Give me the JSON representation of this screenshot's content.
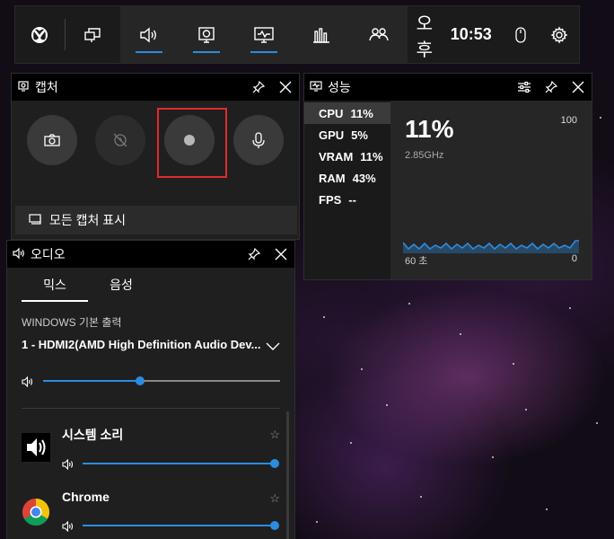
{
  "topbar": {
    "clock_ampm": "오후",
    "clock_time": "10:53"
  },
  "capture": {
    "title": "캡처",
    "show_all_label": "모든 캡처 표시"
  },
  "performance": {
    "title": "성능",
    "metrics": [
      {
        "name": "CPU",
        "value": "11%"
      },
      {
        "name": "GPU",
        "value": "5%"
      },
      {
        "name": "VRAM",
        "value": "11%"
      },
      {
        "name": "RAM",
        "value": "43%"
      },
      {
        "name": "FPS",
        "value": "--"
      }
    ],
    "selected": "CPU",
    "big_value": "11%",
    "frequency": "2.85GHz",
    "max_label": "100",
    "axis_left": "60 초",
    "axis_right": "0"
  },
  "audio": {
    "title": "오디오",
    "tabs": [
      {
        "label": "믹스",
        "active": true
      },
      {
        "label": "음성",
        "active": false
      }
    ],
    "section_label": "WINDOWS 기본 출력",
    "device": "1 - HDMI2(AMD High Definition Audio Dev...",
    "master_volume": 0.41,
    "apps": [
      {
        "name": "시스템 소리",
        "volume": 1.0
      },
      {
        "name": "Chrome",
        "volume": 1.0
      }
    ]
  },
  "colors": {
    "accent": "#2c8ce0",
    "record_highlight": "#e02a2a",
    "panel_bg": "#1f1f1f",
    "header_bg": "#000000"
  }
}
